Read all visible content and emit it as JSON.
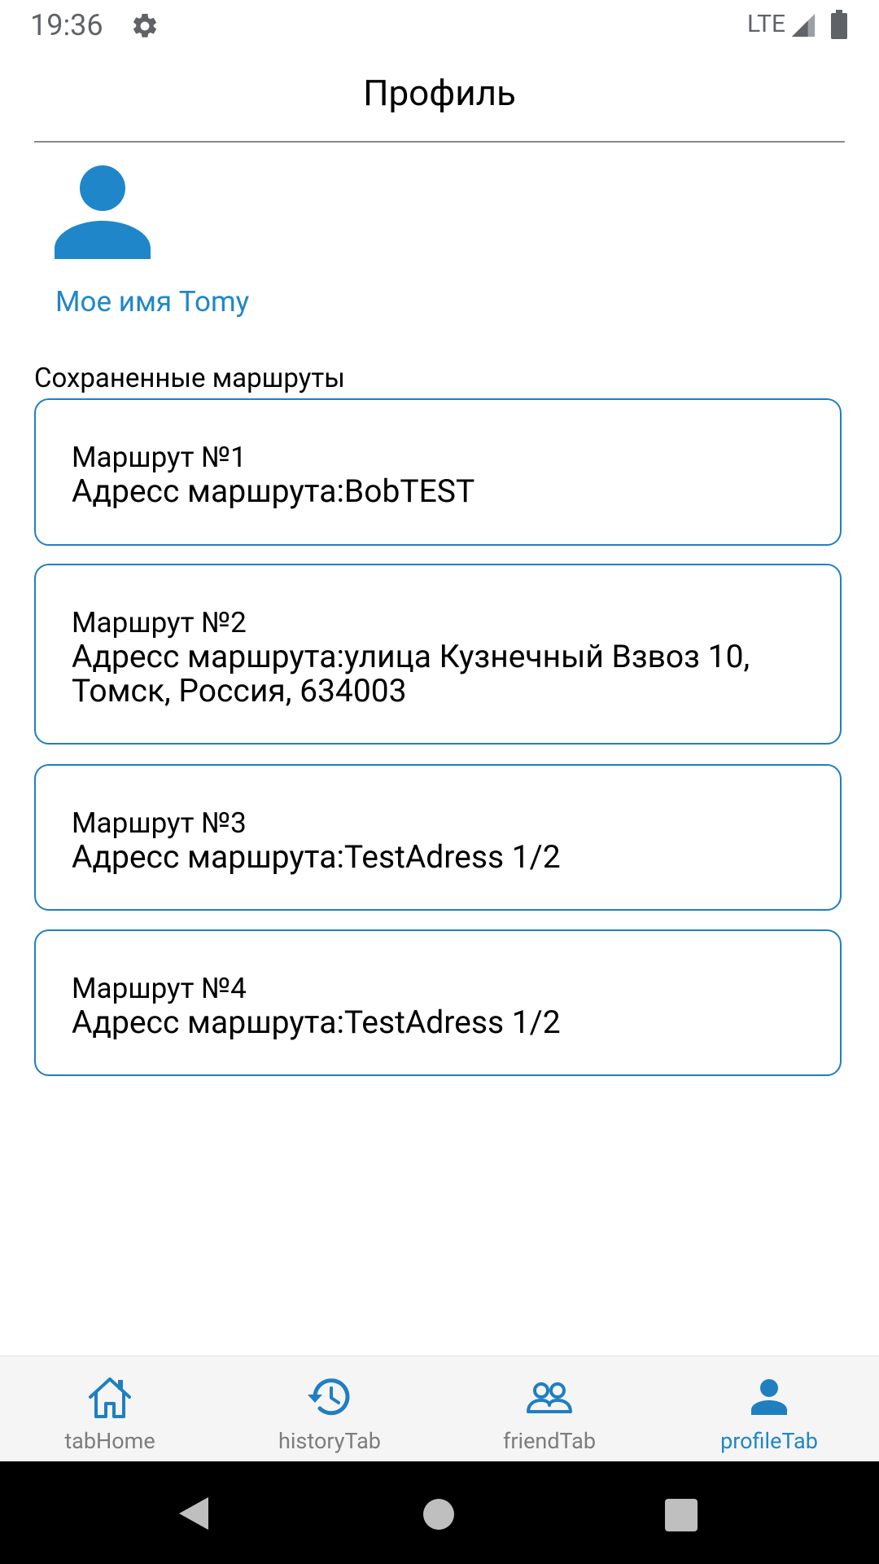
{
  "status_bar": {
    "time": "19:36",
    "network": "LTE",
    "icons": [
      "gear-icon",
      "signal-icon",
      "battery-icon"
    ]
  },
  "header": {
    "title": "Профиль"
  },
  "profile": {
    "avatar_icon": "person-icon",
    "name": "Мое имя Tomy"
  },
  "saved_routes": {
    "title": "Сохраненные маршруты",
    "items": [
      {
        "number": "Маршрут №1",
        "address": "Адресс маршрута:BobTEST"
      },
      {
        "number": "Маршрут №2",
        "address": "Адресс маршрута:улица Кузнечный Взвоз 10, Томск, Россия, 634003"
      },
      {
        "number": "Маршрут №3",
        "address": "Адресс маршрута:TestAdress 1/2"
      },
      {
        "number": "Маршрут №4",
        "address": "Адресс маршрута:TestAdress 1/2"
      }
    ]
  },
  "tabs": [
    {
      "label": "tabHome",
      "icon": "home-icon",
      "active": false
    },
    {
      "label": "historyTab",
      "icon": "history-icon",
      "active": false
    },
    {
      "label": "friendTab",
      "icon": "friends-icon",
      "active": false
    },
    {
      "label": "profileTab",
      "icon": "person-icon",
      "active": true
    }
  ],
  "colors": {
    "accent": "#1f87c9",
    "card_border": "#1f7fc0",
    "tab_inactive": "#7d7d7d",
    "tab_bar_bg": "#f5f5f5"
  }
}
